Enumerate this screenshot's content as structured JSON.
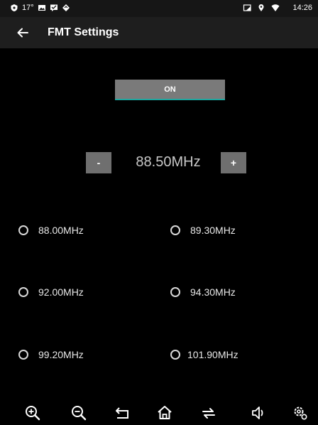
{
  "status_bar": {
    "temperature": "17°",
    "time": "14:26",
    "icons": [
      "shield-icon",
      "image-icon",
      "message-icon",
      "diamond-icon",
      "cast-icon",
      "location-icon",
      "wifi-icon"
    ]
  },
  "app_bar": {
    "title": "FMT Settings",
    "back_icon": "arrow-left-icon"
  },
  "transmitter": {
    "toggle_label": "ON",
    "accent_color": "#1ea7a0"
  },
  "tuner": {
    "minus_label": "-",
    "plus_label": "+",
    "frequency": "88.50MHz"
  },
  "presets": [
    {
      "label": "88.00MHz",
      "selected": false
    },
    {
      "label": "89.30MHz",
      "selected": false
    },
    {
      "label": "92.00MHz",
      "selected": false
    },
    {
      "label": "94.30MHz",
      "selected": false
    },
    {
      "label": "99.20MHz",
      "selected": false
    },
    {
      "label": "101.90MHz",
      "selected": false
    }
  ],
  "nav_bar": {
    "icons": [
      "zoom-in-icon",
      "zoom-out-icon",
      "back-icon",
      "home-icon",
      "switch-icon",
      "volume-icon",
      "settings-icon"
    ]
  }
}
